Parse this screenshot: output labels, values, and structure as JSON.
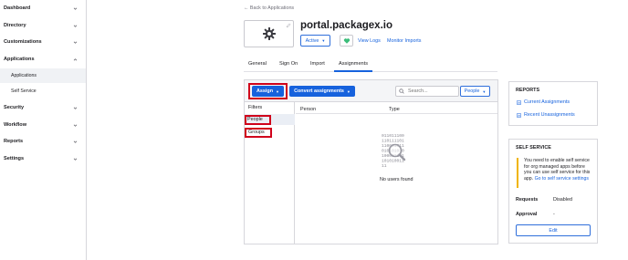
{
  "sidebar": {
    "items": [
      {
        "label": "Dashboard",
        "chevron": "down"
      },
      {
        "label": "Directory",
        "chevron": "down"
      },
      {
        "label": "Customizations",
        "chevron": "down"
      },
      {
        "label": "Applications",
        "chevron": "up"
      },
      {
        "label": "Security",
        "chevron": "down"
      },
      {
        "label": "Workflow",
        "chevron": "down"
      },
      {
        "label": "Reports",
        "chevron": "down"
      },
      {
        "label": "Settings",
        "chevron": "down"
      }
    ],
    "sub_items": [
      {
        "label": "Applications",
        "active": true
      },
      {
        "label": "Self Service",
        "active": false
      }
    ]
  },
  "header": {
    "back_link": "← Back to Applications",
    "app_title": "portal.packagex.io",
    "status_label": "Active",
    "view_logs": "View Logs",
    "monitor_imports": "Monitor Imports"
  },
  "tabs": [
    {
      "label": "General",
      "active": false
    },
    {
      "label": "Sign On",
      "active": false
    },
    {
      "label": "Import",
      "active": false
    },
    {
      "label": "Assignments",
      "active": true
    }
  ],
  "assignments": {
    "assign_label": "Assign",
    "convert_label": "Convert assignments",
    "search_placeholder": "Search...",
    "filter_select": "People",
    "filters_heading": "Filters",
    "filter_people": "People",
    "filter_groups": "Groups",
    "col_person": "Person",
    "col_type": "Type",
    "empty_text": "No users found",
    "empty_art_lines": [
      "011011100",
      "110111101",
      "110001011",
      "010101010",
      "100001101",
      "101010011",
      "11"
    ]
  },
  "reports_card": {
    "title": "REPORTS",
    "current": "Current Assignments",
    "recent": "Recent Unassignments"
  },
  "self_service_card": {
    "title": "SELF SERVICE",
    "notice": "You need to enable self service for org managed apps before you can use self service for this app.",
    "notice_link": "Go to self service settings",
    "requests_key": "Requests",
    "requests_val": "Disabled",
    "approval_key": "Approval",
    "approval_val": "-",
    "edit_label": "Edit"
  },
  "colors": {
    "accent": "#1662dd",
    "highlight_outline": "#d0021b",
    "warning": "#f0b400",
    "status_green": "#3cbd7a"
  },
  "icons": [
    "chevron-down-icon",
    "chevron-up-icon",
    "gear-icon",
    "pencil-icon",
    "heart-icon",
    "search-icon",
    "report-icon",
    "magnifier-icon"
  ]
}
